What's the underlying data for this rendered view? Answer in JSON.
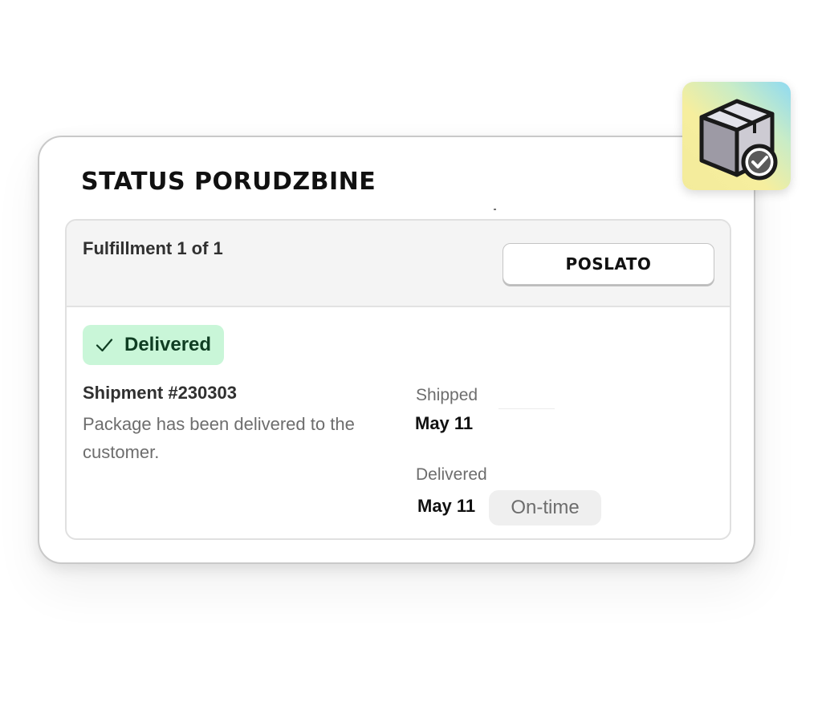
{
  "card": {
    "title": "STATUS PORUDZBINE"
  },
  "fulfillment": {
    "label": "Fulfillment 1 of 1",
    "status_button": "POSLATO"
  },
  "shipment": {
    "status_badge": "Delivered",
    "title": "Shipment #230303",
    "description": "Package has been delivered to the customer.",
    "shipped_label": "Shipped",
    "shipped_date": "May 11",
    "delivered_label": "Delivered",
    "delivered_date": "May 11",
    "timeliness": "On-time"
  },
  "icons": {
    "badge": "checkmark-icon",
    "app": "package-delivered-icon"
  },
  "colors": {
    "badge_bg": "#c9f6d8",
    "badge_text": "#0f3d22",
    "header_bg": "#f4f4f4",
    "muted_text": "#6d6d6d"
  }
}
